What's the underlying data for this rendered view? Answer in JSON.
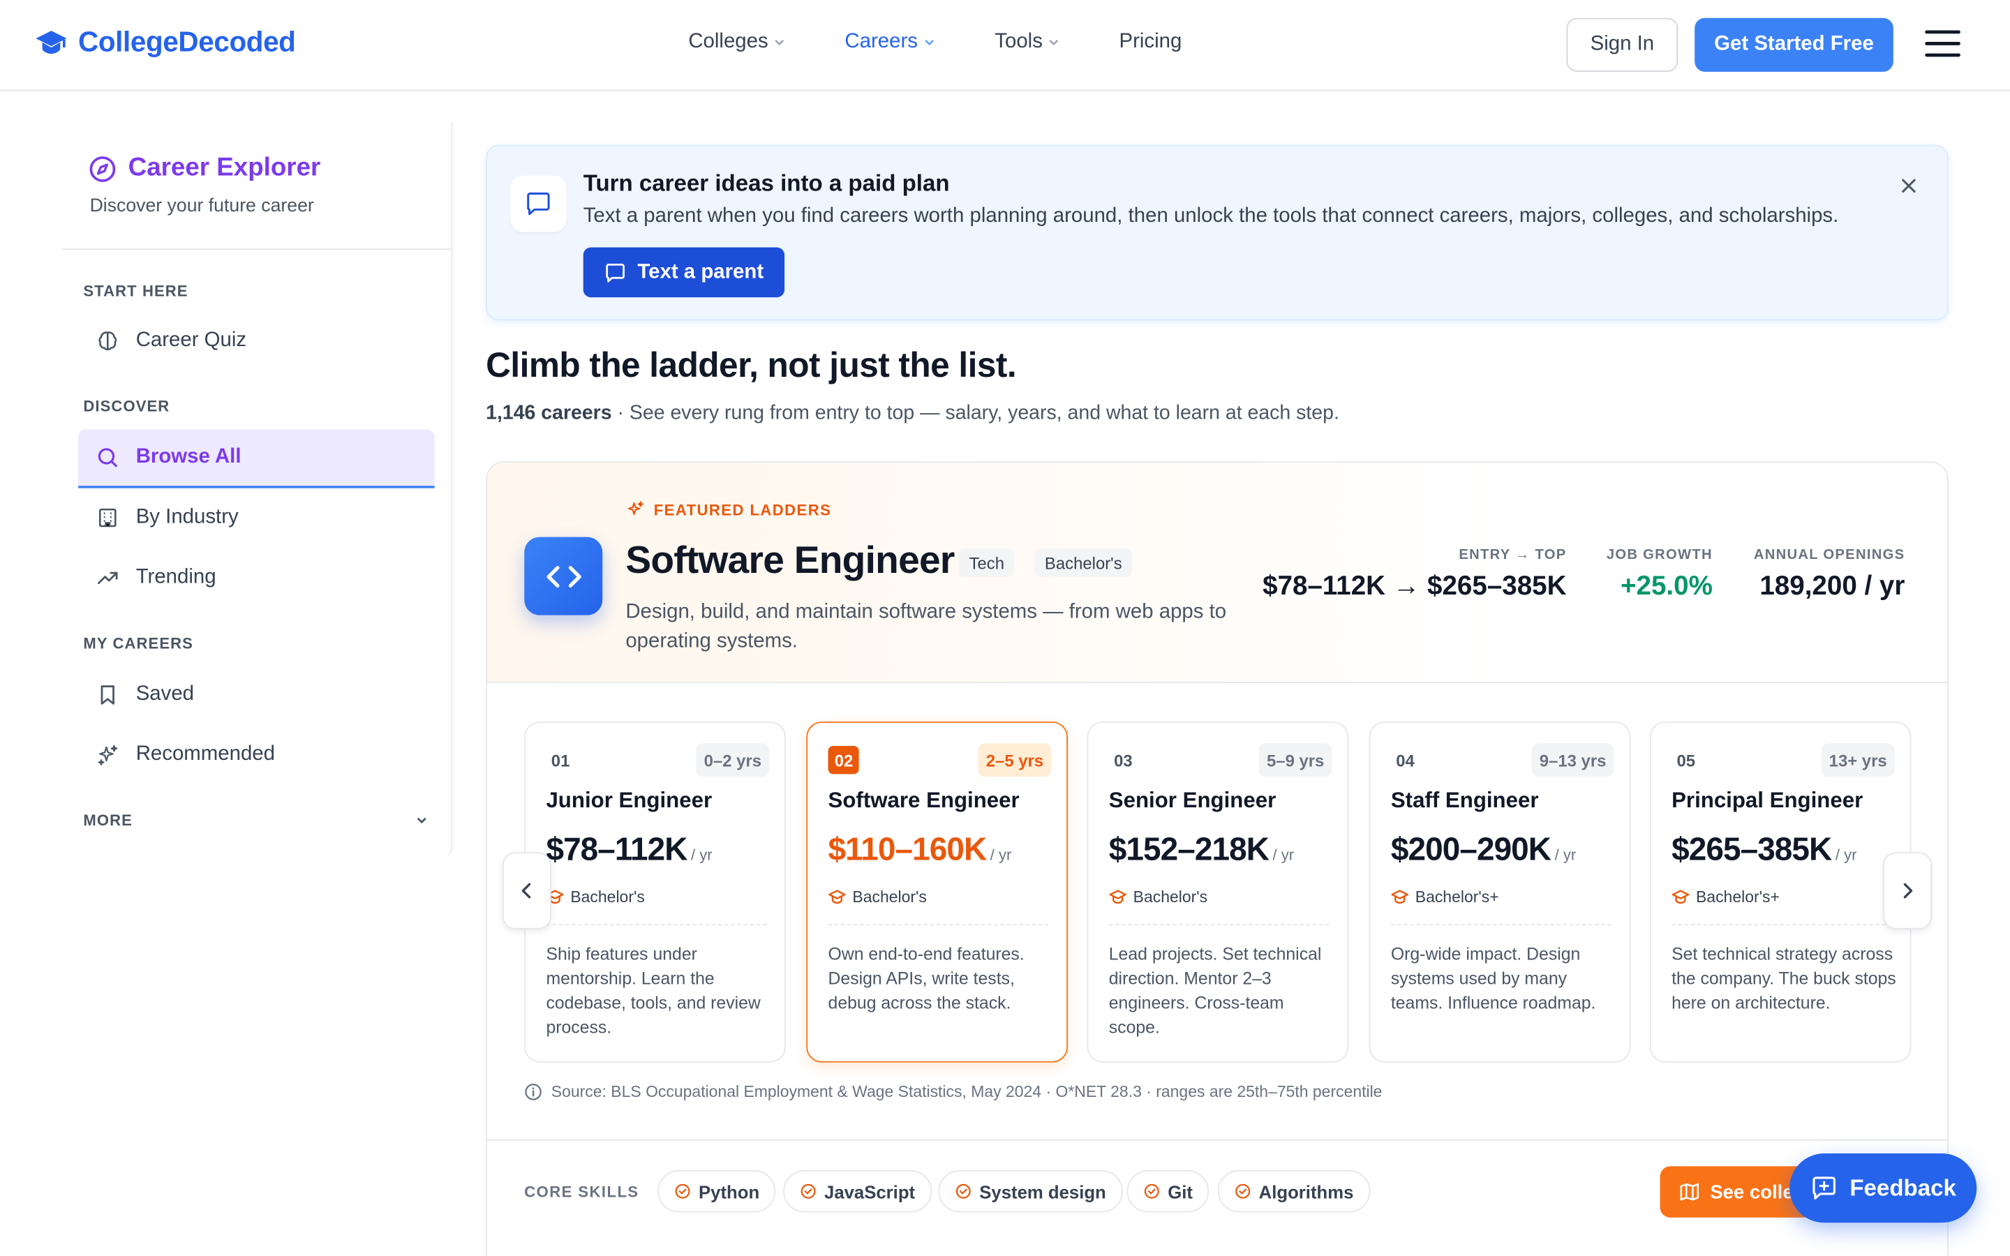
{
  "header": {
    "brand": "CollegeDecoded",
    "nav": [
      {
        "label": "Colleges",
        "dropdown": true,
        "active": false
      },
      {
        "label": "Careers",
        "dropdown": true,
        "active": true
      },
      {
        "label": "Tools",
        "dropdown": true,
        "active": false
      },
      {
        "label": "Pricing",
        "dropdown": false,
        "active": false
      }
    ],
    "sign_in": "Sign In",
    "get_started": "Get Started Free"
  },
  "sidebar": {
    "title": "Career Explorer",
    "subtitle": "Discover your future career",
    "sections": [
      {
        "label": "START HERE",
        "items": [
          {
            "label": "Career Quiz",
            "icon": "brain-icon"
          }
        ]
      },
      {
        "label": "DISCOVER",
        "items": [
          {
            "label": "Browse All",
            "icon": "search-icon",
            "active": true
          },
          {
            "label": "By Industry",
            "icon": "building-icon"
          },
          {
            "label": "Trending",
            "icon": "trending-up-icon"
          }
        ]
      },
      {
        "label": "MY CAREERS",
        "items": [
          {
            "label": "Saved",
            "icon": "bookmark-icon"
          },
          {
            "label": "Recommended",
            "icon": "sparkles-icon"
          }
        ]
      },
      {
        "label": "MORE",
        "collapsed": true
      }
    ]
  },
  "banner": {
    "title": "Turn career ideas into a paid plan",
    "text": "Text a parent when you find careers worth planning around, then unlock the tools that connect careers, majors, colleges, and scholarships.",
    "button": "Text a parent"
  },
  "page": {
    "heading": "Climb the ladder, not just the list.",
    "count": "1,146 careers",
    "subtitle": " · See every rung from entry to top — salary, years, and what to learn at each step."
  },
  "featured": {
    "label": "FEATURED LADDERS",
    "title": "Software Engineer",
    "tags": [
      "Tech",
      "Bachelor's"
    ],
    "description": "Design, build, and maintain software systems — from web apps to operating systems.",
    "stats": [
      {
        "label": "ENTRY → TOP",
        "value": "$78–112K → $265–385K"
      },
      {
        "label": "JOB GROWTH",
        "value": "+25.0%"
      },
      {
        "label": "ANNUAL OPENINGS",
        "value": "189,200 / yr"
      }
    ],
    "rungs": [
      {
        "num": "01",
        "years": "0–2 yrs",
        "title": "Junior Engineer",
        "salary": "$78–112K",
        "unit": "/ yr",
        "degree": "Bachelor's",
        "desc": "Ship features under mentorship. Learn the codebase, tools, and review process."
      },
      {
        "num": "02",
        "years": "2–5 yrs",
        "title": "Software Engineer",
        "salary": "$110–160K",
        "unit": "/ yr",
        "degree": "Bachelor's",
        "desc": "Own end-to-end features. Design APIs, write tests, debug across the stack.",
        "active": true
      },
      {
        "num": "03",
        "years": "5–9 yrs",
        "title": "Senior Engineer",
        "salary": "$152–218K",
        "unit": "/ yr",
        "degree": "Bachelor's",
        "desc": "Lead projects. Set technical direction. Mentor 2–3 engineers. Cross-team scope."
      },
      {
        "num": "04",
        "years": "9–13 yrs",
        "title": "Staff Engineer",
        "salary": "$200–290K",
        "unit": "/ yr",
        "degree": "Bachelor's+",
        "desc": "Org-wide impact. Design systems used by many teams. Influence roadmap."
      },
      {
        "num": "05",
        "years": "13+ yrs",
        "title": "Principal Engineer",
        "salary": "$265–385K",
        "unit": "/ yr",
        "degree": "Bachelor's+",
        "desc": "Set technical strategy across the company. The buck stops here on architecture."
      }
    ],
    "source": "Source: BLS Occupational Employment & Wage Statistics, May 2024 · O*NET 28.3 · ranges are 25th–75th percentile",
    "skills_label": "CORE SKILLS",
    "skills": [
      "Python",
      "JavaScript",
      "System design",
      "Git",
      "Algorithms"
    ],
    "see_button": "See colle"
  },
  "feedback": "Feedback",
  "colors": {
    "primary": "#2563eb",
    "accent": "#ea580c",
    "purple": "#7c3aed",
    "growth": "#059669"
  }
}
